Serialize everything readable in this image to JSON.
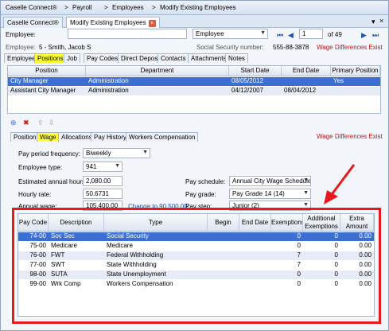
{
  "crumbs": [
    "Caselle Connect®",
    "Payroll",
    "Employees",
    "Modify Existing Employees"
  ],
  "doc_tabs": [
    "Caselle Connect®",
    "Modify Existing Employees"
  ],
  "employee_label": "Employee:",
  "employee_value": "",
  "employee_mode": "Employee",
  "record_number": "1",
  "record_total": "of 49",
  "employee_name_label": "Employee:",
  "employee_name": "5 - Smith, Jacob S",
  "ssn_label": "Social Security number:",
  "ssn_value": "555-88-3878",
  "wage_diff_top": "Wage Differences Exist",
  "main_tabs": [
    "Employee",
    "Positions",
    "Job",
    "Pay Codes",
    "Direct Deposit",
    "Contacts",
    "Attachments",
    "Notes"
  ],
  "positions": {
    "headers": [
      "Position",
      "Department",
      "Start Date",
      "End Date",
      "Primary Position"
    ],
    "rows": [
      [
        "City Manager",
        "Administration",
        "08/05/2012",
        "",
        "Yes"
      ],
      [
        "Assistant City Manager",
        "Administration",
        "04/12/2007",
        "08/04/2012",
        ""
      ]
    ]
  },
  "sub_tabs": [
    "Position",
    "Wage",
    "Allocations",
    "Pay History",
    "Workers Compensation"
  ],
  "wage_diff_sub": "Wage Differences Exist",
  "wage": {
    "pay_period_label": "Pay period frequency:",
    "pay_period": "Biweekly",
    "emp_type_label": "Employee type:",
    "emp_type": "941",
    "annual_hours_label": "Estimated annual hours:",
    "annual_hours": "2,080.00",
    "hourly_rate_label": "Hourly rate:",
    "hourly_rate": "50.6731",
    "annual_wage_label": "Annual wage:",
    "annual_wage": "105,400.00",
    "change_link": "Change to 90,500.00",
    "pay_schedule_label": "Pay schedule:",
    "pay_schedule": "Annual City Wage Schedule",
    "pay_grade_label": "Pay grade:",
    "pay_grade": "Pay Grade 14 (14)",
    "pay_step_label": "Pay step:",
    "pay_step": "Junior (2)"
  },
  "paycodes": {
    "headers": [
      "Pay Code",
      "Description",
      "Type",
      "Begin Date",
      "End Date",
      "Exemptions",
      "Additional Exemptions",
      "Extra Amount"
    ],
    "rows": [
      [
        "74-00",
        "Soc Sec",
        "Social Security",
        "",
        "",
        "0",
        "0",
        "0.00"
      ],
      [
        "75-00",
        "Medicare",
        "Medicare",
        "",
        "",
        "0",
        "0",
        "0.00"
      ],
      [
        "76-00",
        "FWT",
        "Federal Withholding",
        "",
        "",
        "7",
        "0",
        "0.00"
      ],
      [
        "77-00",
        "SWT",
        "State Withholding",
        "",
        "",
        "7",
        "0",
        "0.00"
      ],
      [
        "98-00",
        "SUTA",
        "State Unemployment",
        "",
        "",
        "0",
        "0",
        "0.00"
      ],
      [
        "99-00",
        "Wrk Comp",
        "Workers Compensation",
        "",
        "",
        "0",
        "0",
        "0.00"
      ]
    ]
  },
  "colors": {
    "accent": "#e8191d",
    "selection": "#3b6fd4",
    "highlight": "#ffff33"
  }
}
